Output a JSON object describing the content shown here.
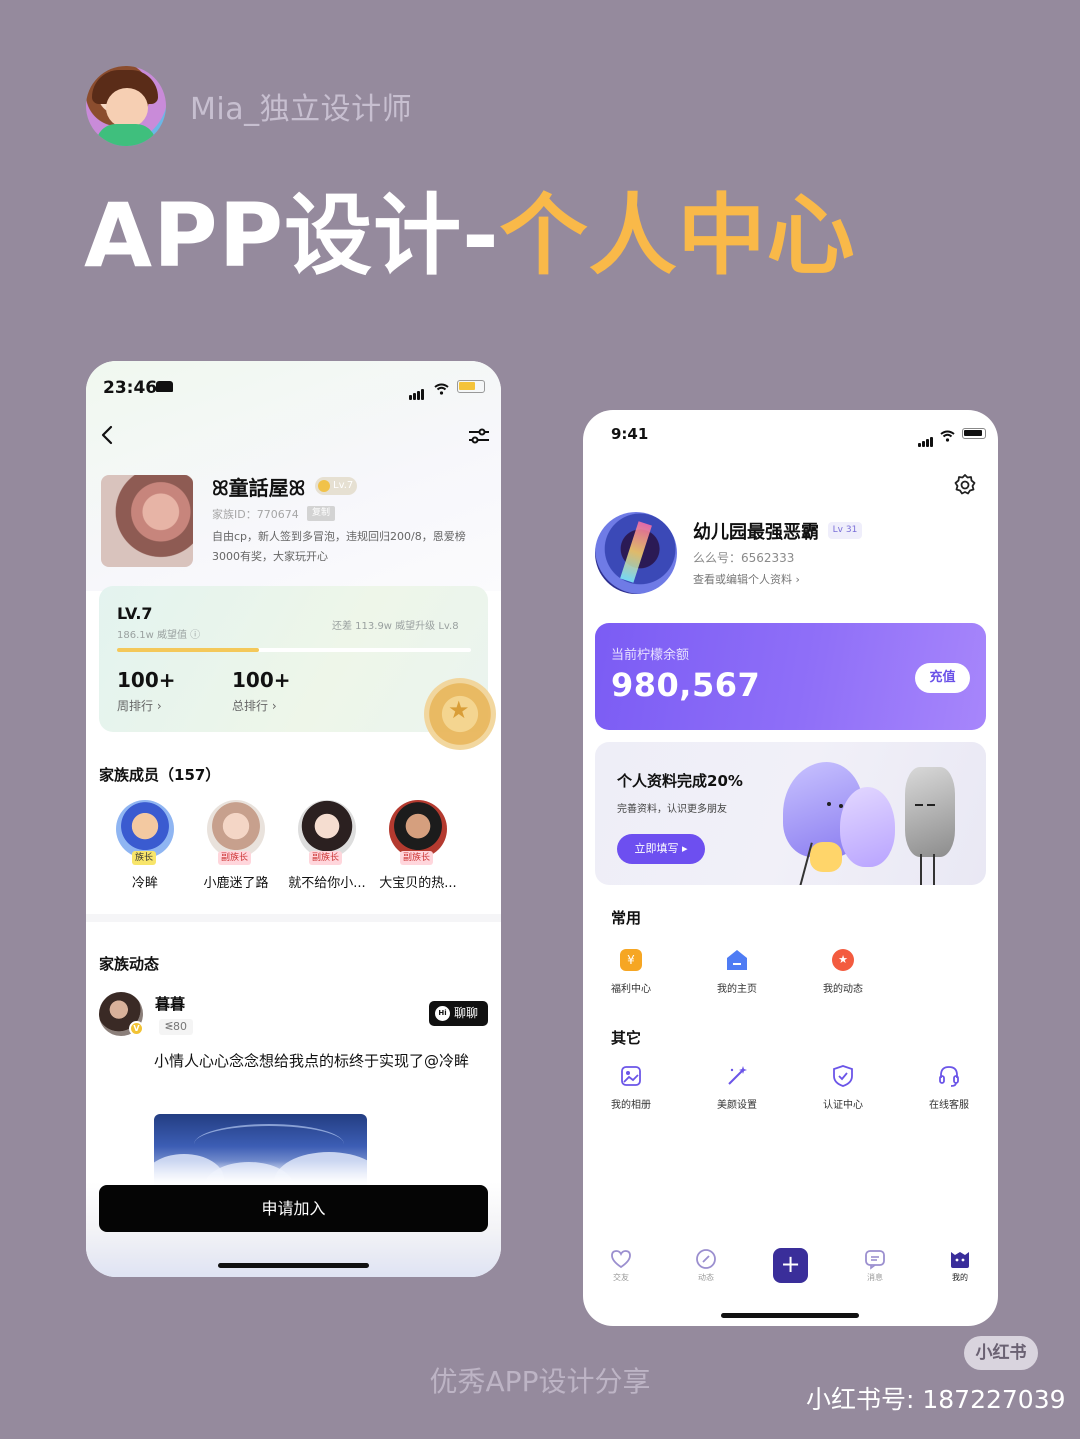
{
  "poster": {
    "author": "Mia_独立设计师",
    "headline_white": "APP设计-",
    "headline_accent": "个人中心",
    "caption": "优秀APP设计分享",
    "badge": "小红书",
    "account": "小红书号: 187227039",
    "accent_color": "#f9b949"
  },
  "left_phone": {
    "status_time": "23:46",
    "family": {
      "name": "ꕤ童話屋ꕤ",
      "level_badge": "Lv.7",
      "id_text": "家族ID：770674",
      "copy_label": "复制",
      "description": "自由cp，新人签到多冒泡，违规回归200/8，恩爱榜3000有奖，大家玩开心"
    },
    "level_card": {
      "title": "LV.7",
      "sub": "186.1w 威望值 ⓘ",
      "gap": "还差 113.9w 威望升级 Lv.8",
      "progress": 0.4,
      "week_rank": "100+",
      "week_label": "周排行 ›",
      "total_rank": "100+",
      "total_label": "总排行 ›"
    },
    "members_title": "家族成员（157）",
    "members": [
      {
        "name": "冷眸",
        "role": "族长"
      },
      {
        "name": "小鹿迷了路",
        "role": "副族长"
      },
      {
        "name": "就不给你小...",
        "role": "副族长"
      },
      {
        "name": "大宝贝的热...",
        "role": "副族长"
      }
    ],
    "feed_title": "家族动态",
    "post": {
      "user": "暮暮",
      "verified": "V",
      "score": "ᓬ80",
      "chat_label": "聊聊",
      "chat_hi": "Hi",
      "text": "小情人心心念念想给我点的标终于实现了@冷眸"
    },
    "join_label": "申请加入"
  },
  "right_phone": {
    "status_time": "9:41",
    "user": {
      "name": "幼儿园最强恶霸",
      "level": "Lv 31",
      "id_text": "么么号：6562333",
      "edit_text": "查看或编辑个人资料 ›"
    },
    "balance": {
      "label": "当前柠檬余额",
      "value": "980,567",
      "button": "充值"
    },
    "profile": {
      "title": "个人资料完成20%",
      "sub": "完善资料，认识更多朋友",
      "button": "立即填写 ▸"
    },
    "common_title": "常用",
    "common": [
      {
        "label": "福利中心",
        "icon": "welfare-icon"
      },
      {
        "label": "我的主页",
        "icon": "home-page-icon"
      },
      {
        "label": "我的动态",
        "icon": "moments-icon"
      }
    ],
    "other_title": "其它",
    "other": [
      {
        "label": "我的相册",
        "icon": "album-icon"
      },
      {
        "label": "美颜设置",
        "icon": "beauty-wand-icon"
      },
      {
        "label": "认证中心",
        "icon": "shield-check-icon"
      },
      {
        "label": "在线客服",
        "icon": "headset-icon"
      }
    ],
    "tabs": [
      {
        "label": "交友",
        "icon": "heart-icon"
      },
      {
        "label": "动态",
        "icon": "compass-icon"
      },
      {
        "label": "消息",
        "icon": "message-icon"
      },
      {
        "label": "我的",
        "icon": "mine-icon"
      }
    ],
    "plus": "+",
    "brand_color": "#7b5cf4"
  }
}
